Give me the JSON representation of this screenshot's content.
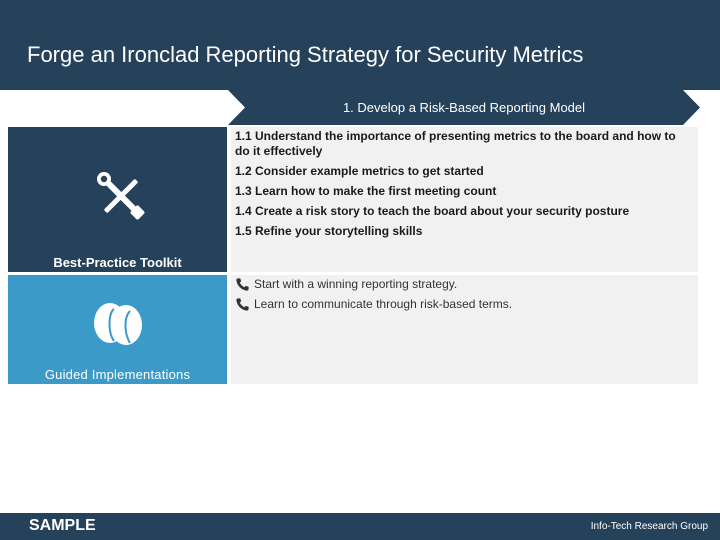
{
  "slide": {
    "title": "Forge an Ironclad Reporting Strategy for Security Metrics"
  },
  "phase": {
    "label": "1. Develop a Risk-Based Reporting Model"
  },
  "toolkit": {
    "label": "Best-Practice Toolkit",
    "icon": "tools-icon",
    "steps": [
      "1.1 Understand the importance of presenting metrics to the board and how to do it effectively",
      "1.2 Consider example metrics to get started",
      "1.3 Learn how to make the first meeting count",
      "1.4 Create a risk story to teach the board about your security posture",
      "1.5 Refine your storytelling skills"
    ]
  },
  "guided": {
    "label": "Guided Implementations",
    "icon": "people-heads-icon",
    "calls": [
      "Start with a winning reporting strategy.",
      "Learn to communicate through risk-based terms."
    ]
  },
  "footer": {
    "sample": "SAMPLE",
    "brand": "Info-Tech Research Group"
  },
  "colors": {
    "navy": "#26415a",
    "blue": "#3c9ac8",
    "panel": "#f1f1f1"
  }
}
